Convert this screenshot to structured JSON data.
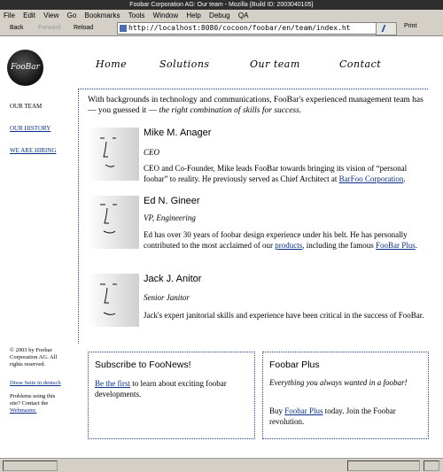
{
  "window": {
    "title": "Foobar Corporation AG: Our team - Mozilla {Build ID: 2003040105}"
  },
  "menu": [
    "File",
    "Edit",
    "View",
    "Go",
    "Bookmarks",
    "Tools",
    "Window",
    "Help",
    "Debug",
    "QA"
  ],
  "nav": {
    "back": "Back",
    "forward": "Forward",
    "reload": "Reload",
    "url": "http://localhost:8080/cocoon/foobar/en/team/index.ht",
    "print": "Print"
  },
  "site": {
    "logo": "FooBar",
    "topnav": [
      "Home",
      "Solutions",
      "Our team",
      "Contact"
    ],
    "sidebar": {
      "current": "OUR TEAM",
      "links": [
        "OUR HISTORY",
        "WE ARE HIRING"
      ]
    },
    "footer": {
      "copyright": "© 2003 by Foobar Corporation AG. All rights reserved.",
      "lang_link": "Diese Seite in deutsch",
      "problems": "Problems using this site? Contact the",
      "webmaster": "Webmaster."
    }
  },
  "intro": {
    "text": "With backgrounds in technology and communications, FooBar's experienced management team has — you guessed it — ",
    "emph": "the right combination of skills for success."
  },
  "team": [
    {
      "name": "Mike M. Anager",
      "role": "CEO",
      "bio_pre": "CEO and Co-Founder, Mike leads FooBar towards bringing its vision of “personal foobar” to reality. He previously served as Chief Architect at ",
      "bio_link": "BarFoo Corporation",
      "bio_post": "."
    },
    {
      "name": "Ed N. Gineer",
      "role": "VP, Engineering",
      "bio_pre": "Ed has over 30 years of foobar design experience under his belt. He has personally contributed to the most acclaimed of our ",
      "bio_link": "products",
      "bio_mid": ", including the famous ",
      "bio_link2": "FooBar Plus",
      "bio_post": "."
    },
    {
      "name": "Jack J. Anitor",
      "role": "Senior Janitor",
      "bio_pre": "Jack's expert janitorial skills and experience have been critical in the success of FooBar.",
      "bio_link": "",
      "bio_post": ""
    }
  ],
  "boxes": {
    "news": {
      "title": "Subscribe to FooNews!",
      "link": "Be the first",
      "text": " to learn about exciting foobar developments."
    },
    "plus": {
      "title": "Foobar Plus",
      "tagline": "Everything you always wanted in a foobar!",
      "pre": "Buy ",
      "link": "Foobar Plus",
      "post": " today. Join the Foobar revolution."
    }
  }
}
